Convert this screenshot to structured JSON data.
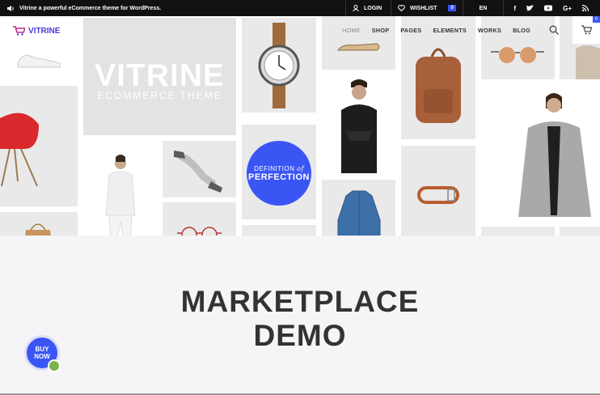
{
  "topbar": {
    "tagline": "Vitrine a powerful eCommerce theme for WordPress.",
    "login": "LOGIN",
    "wishlist": "WISHLIST",
    "wishlist_count": "0",
    "language": "EN",
    "socials": [
      "facebook-icon",
      "twitter-icon",
      "youtube-icon",
      "google-plus-icon",
      "rss-icon"
    ]
  },
  "header": {
    "logo": "VITRINE",
    "nav": [
      "HOME",
      "SHOP",
      "PAGES",
      "ELEMENTS",
      "WORKS",
      "BLOG"
    ],
    "cart_count": "0"
  },
  "hero": {
    "title": "VITRINE",
    "subtitle": "ECOMMERCE THEME",
    "badge_line1": "DEFINITION",
    "badge_script": "of",
    "badge_line2": "PERFECTION"
  },
  "main": {
    "heading_line1": "MARKETPLACE",
    "heading_line2": "DEMO",
    "buy_line1": "BUY",
    "buy_line2": "NOW"
  },
  "colors": {
    "accent": "#3b55f5",
    "topbar": "#111111",
    "logo": "#4a3bd6"
  }
}
